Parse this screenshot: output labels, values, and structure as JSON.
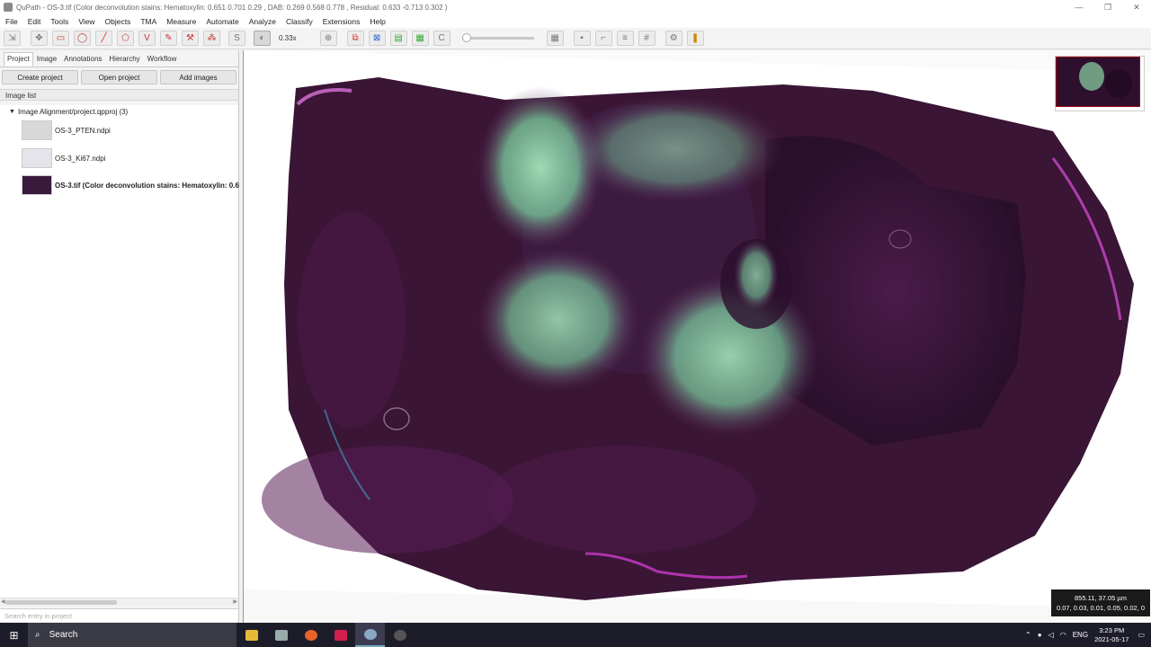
{
  "window": {
    "title": "QuPath - OS-3.tif (Color deconvolution stains: Hematoxylin: 0.651 0.701 0.29 , DAB: 0.269 0.568 0.778 , Residual: 0.633 -0.713 0.302 )",
    "controls": [
      "—",
      "❐",
      "✕"
    ]
  },
  "menu": [
    "File",
    "Edit",
    "Tools",
    "View",
    "Objects",
    "TMA",
    "Measure",
    "Automate",
    "Analyze",
    "Classify",
    "Extensions",
    "Help"
  ],
  "toolbar": {
    "zoom_label": "0.33x",
    "tools_left": [
      {
        "icon": "move-tool-icon",
        "glyph": "✥"
      },
      {
        "icon": "rectangle-tool-icon",
        "glyph": "▭"
      },
      {
        "icon": "ellipse-tool-icon",
        "glyph": "◯"
      },
      {
        "icon": "line-tool-icon",
        "glyph": "╱"
      },
      {
        "icon": "polygon-tool-icon",
        "glyph": "⬠"
      },
      {
        "icon": "polyline-tool-icon",
        "glyph": "V"
      },
      {
        "icon": "brush-tool-icon",
        "glyph": "✎"
      },
      {
        "icon": "wand-tool-icon",
        "glyph": "⚒"
      },
      {
        "icon": "points-tool-icon",
        "glyph": "⁂"
      },
      {
        "icon": "selection-mode-icon",
        "glyph": "S"
      }
    ]
  },
  "left_panel": {
    "tabs": [
      "Project",
      "Image",
      "Annotations",
      "Hierarchy",
      "Workflow"
    ],
    "active_tab": "Project",
    "buttons": {
      "create": "Create project",
      "open": "Open project",
      "add": "Add images"
    },
    "image_list_label": "Image list",
    "project_node": "Image Alignment/project.qpproj (3)",
    "entries": [
      {
        "name": "OS-3_PTEN.ndpi",
        "thumb_color": "#d8d8d8"
      },
      {
        "name": "OS-3_Ki67.ndpi",
        "thumb_color": "#e4e4ea"
      },
      {
        "name": "OS-3.tif (Color deconvolution stains: Hematoxylin: 0.6",
        "thumb_color": "#3a1a3c"
      }
    ],
    "search_placeholder": "Search entry in project"
  },
  "viewer": {
    "cursor_readout_line1": "855.11, 37.05 µm",
    "cursor_readout_line2": "0.07, 0.03, 0.01, 0.05, 0.02, 0"
  },
  "taskbar": {
    "search_label": "Search",
    "tray_lang": "ENG",
    "time": "3:23 PM",
    "date": "2021-05-17"
  }
}
